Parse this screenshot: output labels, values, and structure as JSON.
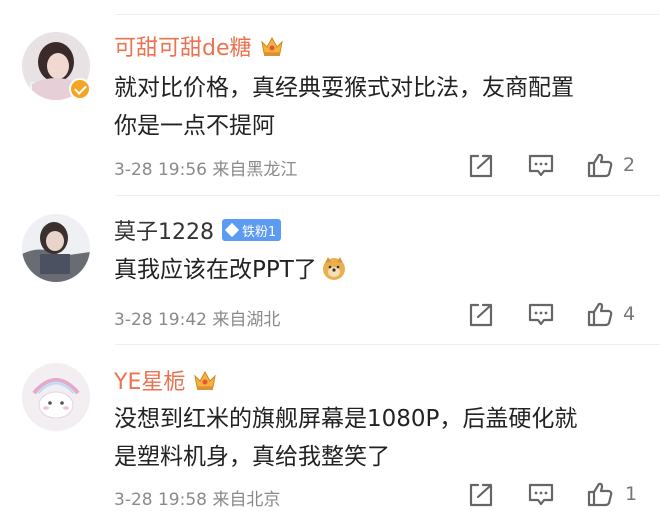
{
  "comments": [
    {
      "username": "可甜可甜de糖",
      "text_lines": [
        "就对比价格，真经典耍猴式对比法，友商配置",
        "你是一点不提阿"
      ],
      "timestamp": "3-28 19:56",
      "location": "来自黑龙江",
      "likes": "2",
      "verified": true,
      "badge": "crown-icon"
    },
    {
      "username": "莫子1228",
      "fan_badge": "铁粉1",
      "text": "真我应该在改PPT了",
      "emoji": "doge-emoji",
      "timestamp": "3-28 19:42",
      "location": "来自湖北",
      "likes": "4"
    },
    {
      "username": "YE星栀",
      "text_lines": [
        "没想到红米的旗舰屏幕是1080P，后盖硬化就",
        "是塑料机身，真给我整笑了"
      ],
      "timestamp": "3-28 19:58",
      "location": "来自北京",
      "likes": "1",
      "badge": "crown-icon"
    }
  ],
  "colors": {
    "username_vip": "#eb7350",
    "fan_badge": "#5b9bf1",
    "meta": "#8a8a8a"
  }
}
